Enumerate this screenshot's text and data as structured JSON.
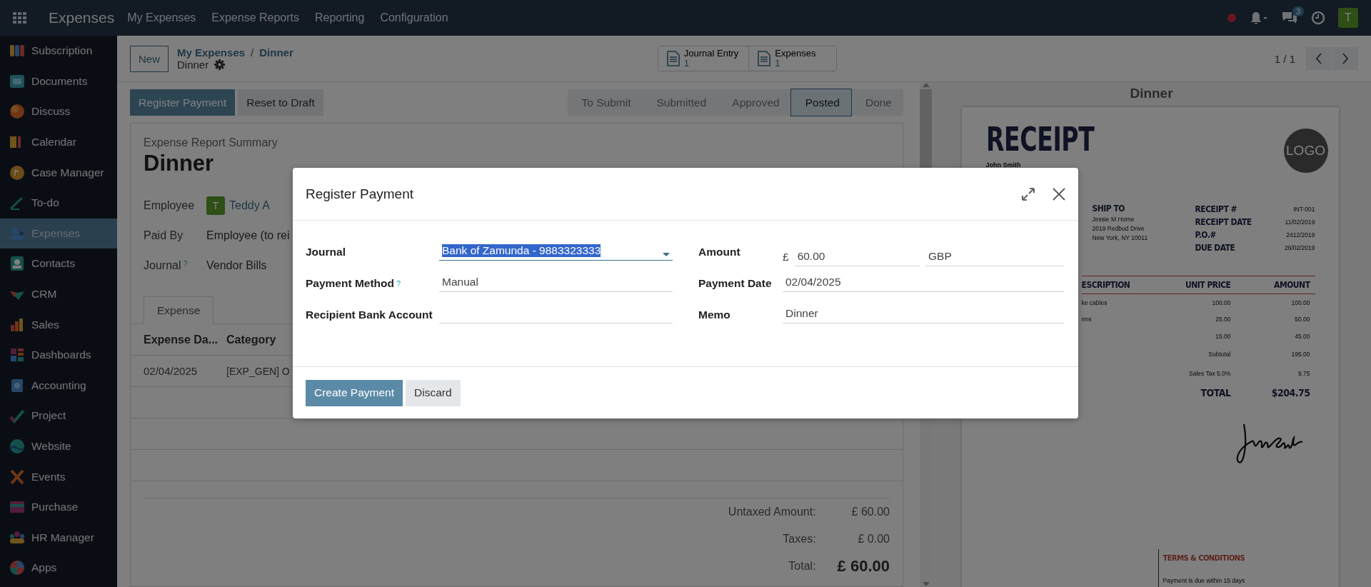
{
  "top_bar": {
    "app_name": "Expenses",
    "menus": [
      "My Expenses",
      "Expense Reports",
      "Reporting",
      "Configuration"
    ],
    "message_count": "3",
    "user_initial": "T"
  },
  "sidebar": {
    "items": [
      {
        "label": "Subscription",
        "selected": false
      },
      {
        "label": "Documents",
        "selected": false
      },
      {
        "label": "Discuss",
        "selected": false
      },
      {
        "label": "Calendar",
        "selected": false
      },
      {
        "label": "Case Manager",
        "selected": false
      },
      {
        "label": "To-do",
        "selected": false
      },
      {
        "label": "Expenses",
        "selected": true
      },
      {
        "label": "Contacts",
        "selected": false
      },
      {
        "label": "CRM",
        "selected": false
      },
      {
        "label": "Sales",
        "selected": false
      },
      {
        "label": "Dashboards",
        "selected": false
      },
      {
        "label": "Accounting",
        "selected": false
      },
      {
        "label": "Project",
        "selected": false
      },
      {
        "label": "Website",
        "selected": false
      },
      {
        "label": "Events",
        "selected": false
      },
      {
        "label": "Purchase",
        "selected": false
      },
      {
        "label": "HR Manager",
        "selected": false
      },
      {
        "label": "Apps",
        "selected": false
      }
    ]
  },
  "control_panel": {
    "new_button": "New",
    "breadcrumb": [
      "My Expenses",
      "Dinner"
    ],
    "breadcrumb_separator": "/",
    "record_name": "Dinner",
    "smart_buttons": [
      {
        "label": "Journal Entry",
        "count": "1"
      },
      {
        "label": "Expenses",
        "count": "1"
      }
    ],
    "pager": "1 / 1"
  },
  "action_buttons": [
    {
      "label": "Register Payment",
      "primary": true
    },
    {
      "label": "Reset to Draft",
      "primary": false
    }
  ],
  "status_stages": [
    {
      "label": "To Submit",
      "selected": false
    },
    {
      "label": "Submitted",
      "selected": false
    },
    {
      "label": "Approved",
      "selected": false
    },
    {
      "label": "Posted",
      "selected": true
    },
    {
      "label": "Done",
      "selected": false
    }
  ],
  "form": {
    "subtitle": "Expense Report Summary",
    "title": "Dinner",
    "fields": [
      {
        "label": "Employee",
        "kind": "avatar",
        "avatar": "T",
        "value": "Teddy A"
      },
      {
        "label": "Paid By",
        "kind": "text",
        "value": "Employee (to rei"
      },
      {
        "label": "Journal",
        "help": "?",
        "kind": "text",
        "value": "Vendor Bills"
      }
    ],
    "tabs": [
      {
        "label": "Expense",
        "selected": true
      }
    ],
    "table": {
      "columns": [
        "Expense Da...",
        "Category"
      ],
      "rows": [
        [
          "02/04/2025",
          "[EXP_GEN] O"
        ]
      ]
    },
    "totals": [
      {
        "label": "Untaxed Amount:",
        "value": "£ 60.00",
        "kind": "line"
      },
      {
        "label": "Taxes:",
        "value": "£ 0.00",
        "kind": "line"
      },
      {
        "label": "Total:",
        "value": "£ 60.00",
        "kind": "total"
      }
    ]
  },
  "preview": {
    "title": "Dinner",
    "receipt": {
      "heading": "RECEIPT",
      "logo": "LOGO",
      "from_name": "John Smith",
      "ship_to": {
        "heading": "SHIP TO",
        "lines": [
          "Jessie M Horne",
          "2019 Redbud Drive",
          "New York, NY 10011"
        ]
      },
      "meta": [
        {
          "label": "RECEIPT #",
          "value": "INT-001"
        },
        {
          "label": "RECEIPT DATE",
          "value": "11/02/2019"
        },
        {
          "label": "P.O.#",
          "value": "2412/2019"
        },
        {
          "label": "DUE DATE",
          "value": "26/02/2019"
        }
      ],
      "columns": [
        "ESCRIPTION",
        "UNIT PRICE",
        "AMOUNT"
      ],
      "items": [
        {
          "description": "ke cables",
          "unit_price": "100.00",
          "amount": "100.00"
        },
        {
          "description": "rms",
          "unit_price": "25.00",
          "amount": "50.00"
        },
        {
          "unit_price": "15.00",
          "amount": "45.00"
        }
      ],
      "summary": [
        {
          "label": "Subtotal",
          "value": "195.00",
          "kind": "line"
        },
        {
          "label": "Sales Tax 5.0%",
          "value": "9.75",
          "kind": "line"
        },
        {
          "label": "TOTAL",
          "value": "$204.75",
          "kind": "total"
        }
      ],
      "terms": {
        "heading": "TERMS & CONDITIONS",
        "text": "Payment is due within 15 days"
      }
    }
  },
  "dialog": {
    "title": "Register Payment",
    "left_fields": [
      {
        "label": "Journal",
        "kind": "select",
        "value": "Bank of Zamunda - 9883323333",
        "text_selected": true
      },
      {
        "label": "Payment Method",
        "help": "?",
        "kind": "text",
        "value": "Manual"
      },
      {
        "label": "Recipient Bank Account",
        "kind": "text"
      }
    ],
    "right_fields": [
      {
        "label": "Amount",
        "kind": "money",
        "symbol": "£",
        "value": "60.00",
        "currency": "GBP"
      },
      {
        "label": "Payment Date",
        "kind": "text",
        "value": "02/04/2025"
      },
      {
        "label": "Memo",
        "kind": "text",
        "value": "Dinner"
      }
    ],
    "buttons": [
      {
        "label": "Create Payment",
        "primary": true
      },
      {
        "label": "Discard",
        "primary": false
      }
    ]
  }
}
